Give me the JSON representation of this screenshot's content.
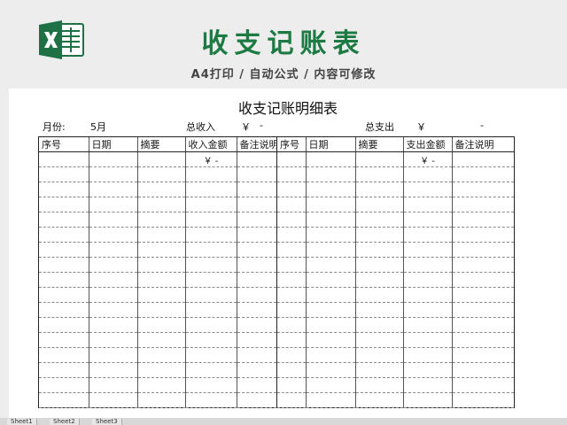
{
  "banner": {
    "title": "收支记账表",
    "subtitle": "A4打印 / 自动公式 / 内容可修改"
  },
  "sheet": {
    "title": "收支记账明细表",
    "month_label": "月份:",
    "month_value": "5月",
    "income_total_label": "总收入",
    "income_total_currency": "￥",
    "income_total_value": "-",
    "expense_total_label": "总支出",
    "expense_total_currency": "￥",
    "expense_total_value": "-"
  },
  "income_table": {
    "headers": [
      "序号",
      "日期",
      "摘要",
      "收入金额",
      "备注说明"
    ],
    "first_amount": "￥    -"
  },
  "expense_table": {
    "headers": [
      "序号",
      "日期",
      "摘要",
      "支出金额",
      "备注说明"
    ],
    "first_amount": "￥    -"
  },
  "tabs": [
    "Sheet1",
    "Sheet2",
    "Sheet3"
  ],
  "colors": {
    "brand_green": "#1d7a43",
    "excel_green": "#1e7145"
  }
}
